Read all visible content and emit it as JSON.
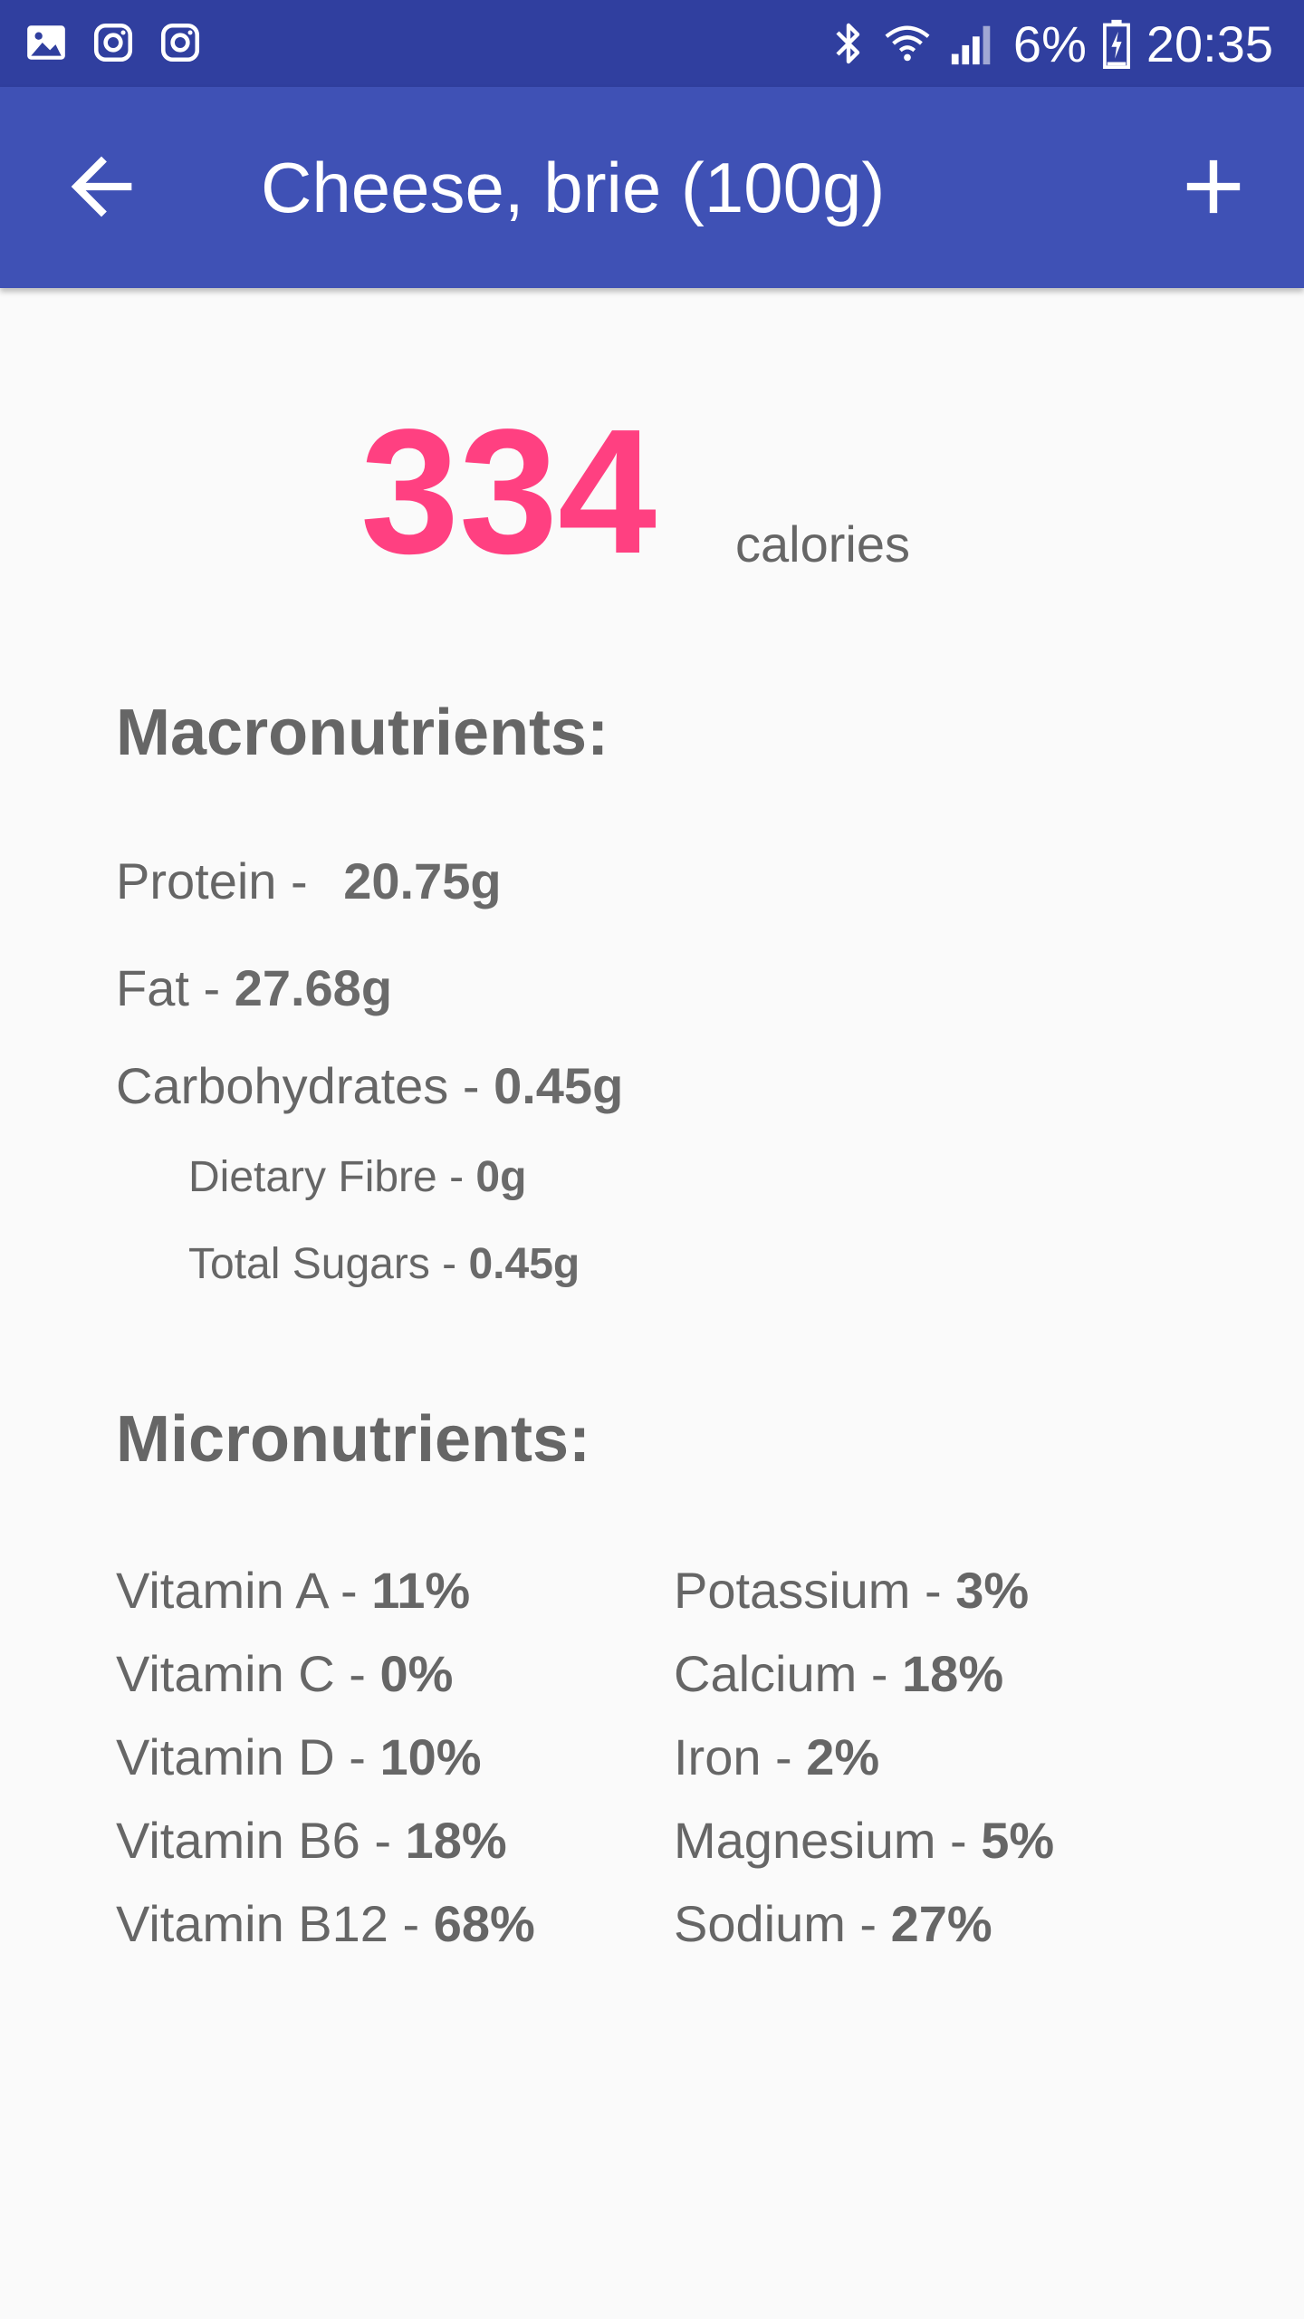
{
  "status_bar": {
    "left_icons": [
      "gallery-icon",
      "instagram-icon",
      "instagram-icon"
    ],
    "right_icons": [
      "bluetooth-icon",
      "wifi-icon",
      "signal-icon",
      "battery-charging-icon"
    ],
    "battery": "6%",
    "time": "20:35",
    "background": "#303f9f"
  },
  "app_bar": {
    "title": "Cheese, brie (100g)",
    "back_icon": "arrow-back-icon",
    "add_icon": "plus-icon",
    "background": "#3f51b5"
  },
  "calories": {
    "value": "334",
    "label": "calories",
    "color": "#ff4081"
  },
  "macronutrients": {
    "title": "Macronutrients:",
    "protein": {
      "label": "Protein - ",
      "value": "20.75g"
    },
    "fat": {
      "label": "Fat - ",
      "value": "27.68g"
    },
    "carbohydrates": {
      "label": "Carbohydrates - ",
      "value": "0.45g"
    },
    "fibre": {
      "label": "Dietary Fibre - ",
      "value": "0g"
    },
    "sugars": {
      "label": "Total Sugars - ",
      "value": "0.45g"
    }
  },
  "micronutrients": {
    "title": "Micronutrients:",
    "left": [
      {
        "label": "Vitamin A - ",
        "value": "11%"
      },
      {
        "label": "Vitamin C - ",
        "value": "0%"
      },
      {
        "label": "Vitamin D - ",
        "value": "10%"
      },
      {
        "label": "Vitamin B6 - ",
        "value": "18%"
      },
      {
        "label": "Vitamin B12 - ",
        "value": "68%"
      }
    ],
    "right": [
      {
        "label": "Potassium - ",
        "value": "3%"
      },
      {
        "label": "Calcium - ",
        "value": "18%"
      },
      {
        "label": "Iron - ",
        "value": "2%"
      },
      {
        "label": "Magnesium - ",
        "value": "5%"
      },
      {
        "label": "Sodium - ",
        "value": "27%"
      }
    ]
  }
}
